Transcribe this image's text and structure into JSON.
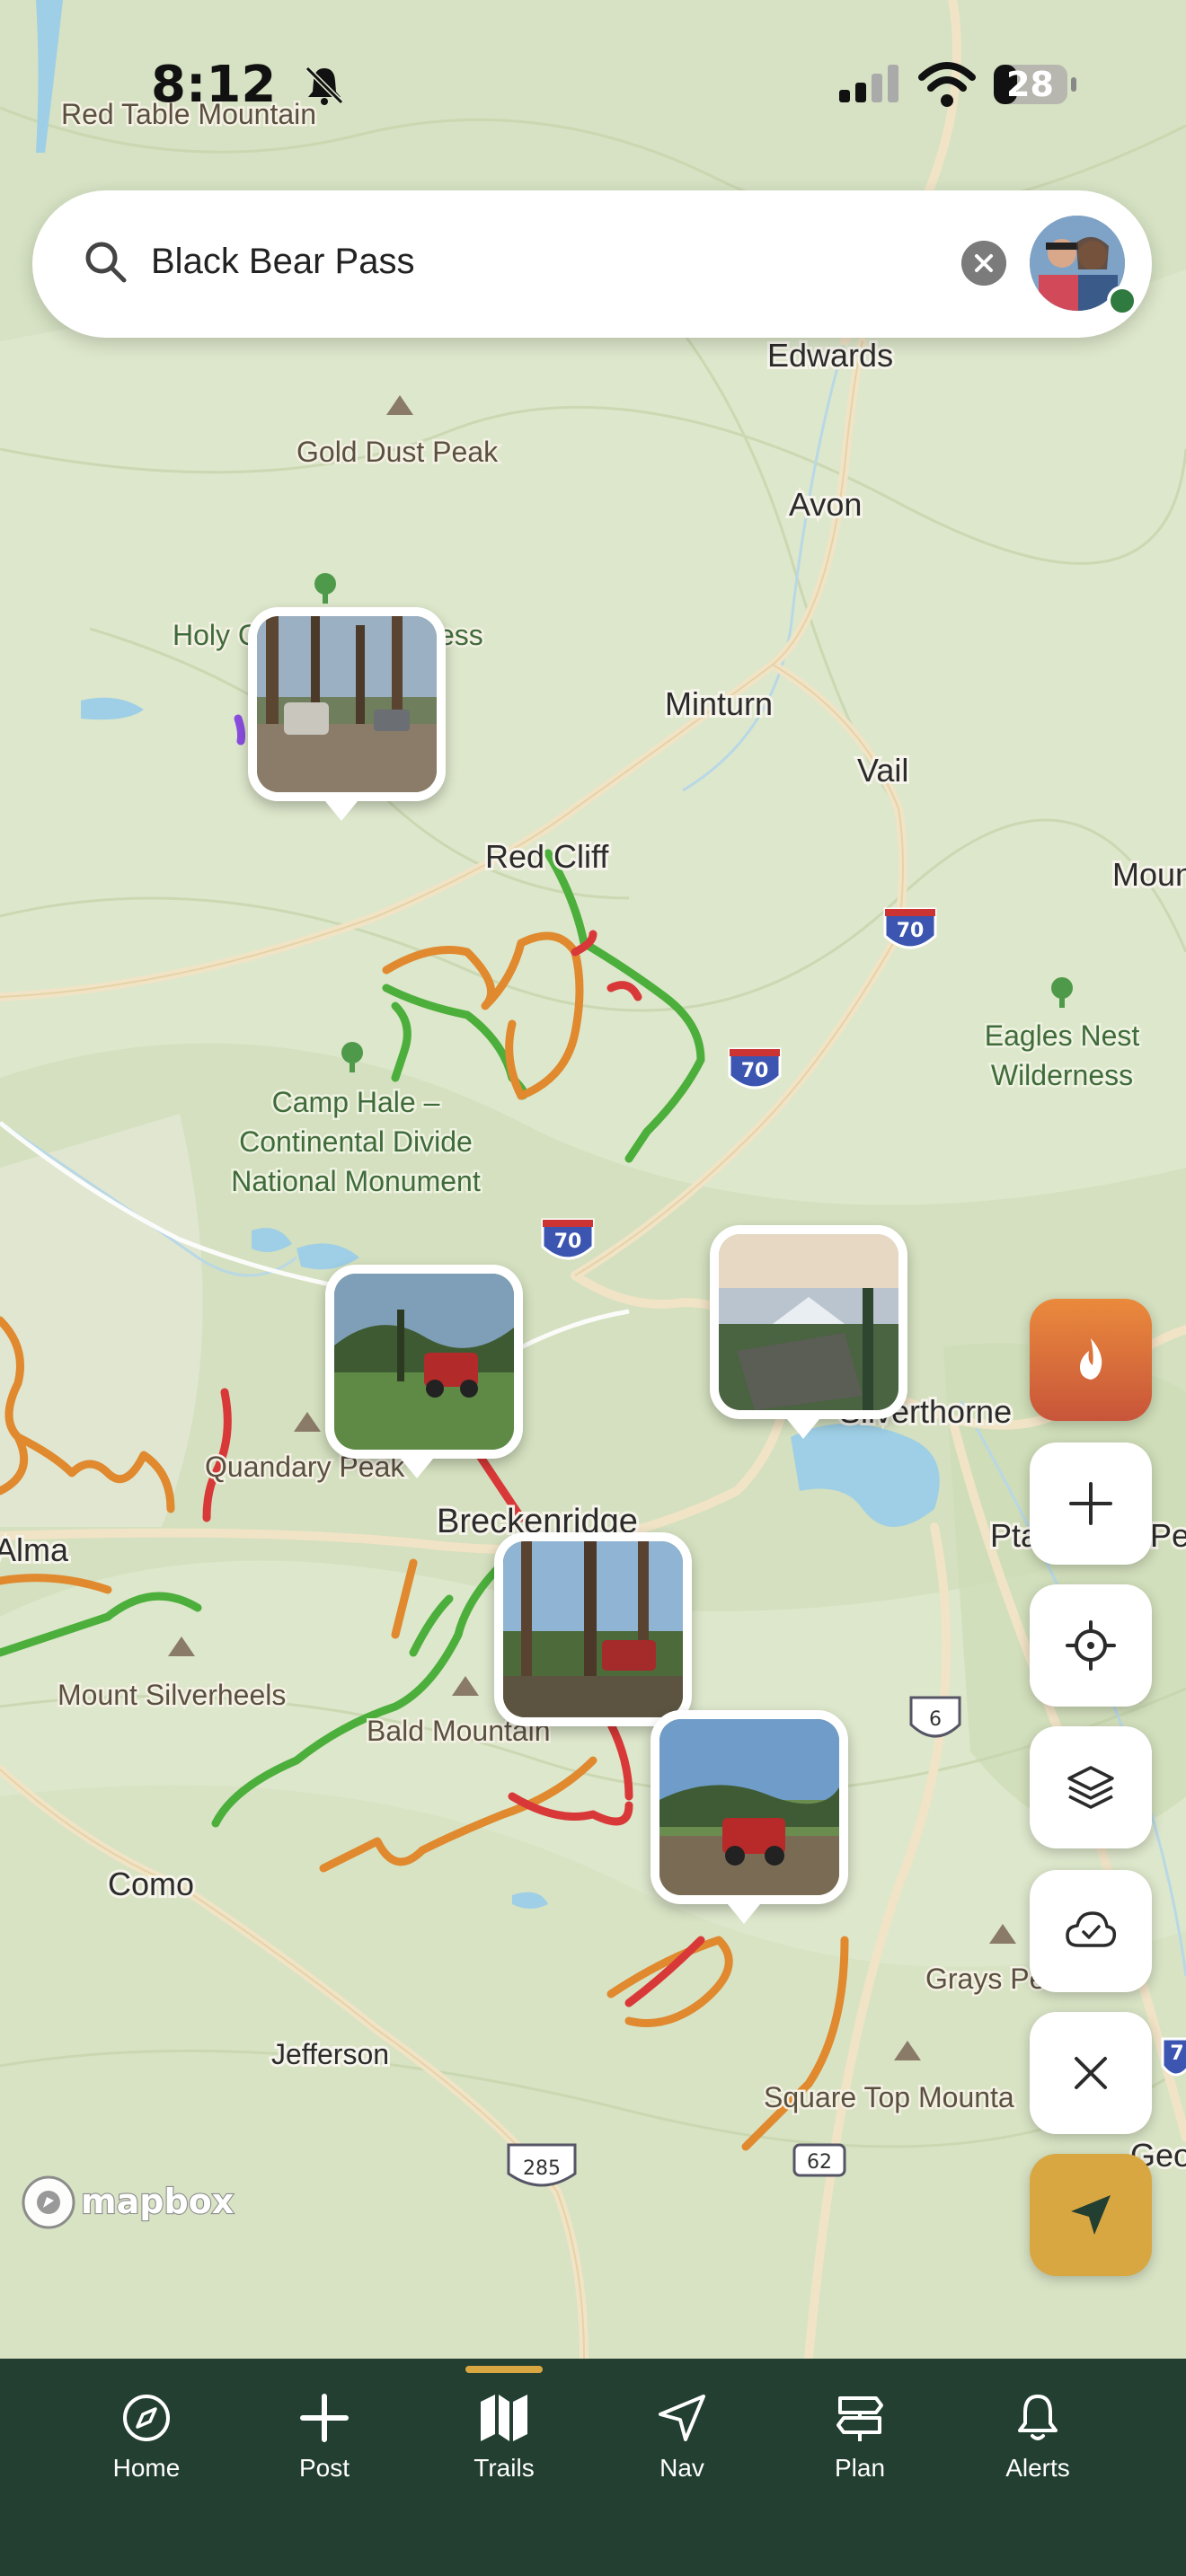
{
  "status_bar": {
    "time": "8:12",
    "battery": "28"
  },
  "search": {
    "query": "Black Bear Pass"
  },
  "map_labels": {
    "red_table_mountain": "Red Table Mountain",
    "edwards": "Edwards",
    "gold_dust_peak": "Gold Dust Peak",
    "avon": "Avon",
    "holy_cross": "Holy C",
    "holy_cross_tail": "ess",
    "minturn": "Minturn",
    "vail": "Vail",
    "red_cliff": "Red Cliff",
    "mount_right": "Moun",
    "eagles_nest_1": "Eagles Nest",
    "eagles_nest_2": "Wilderness",
    "camp_hale_1": "Camp Hale –",
    "camp_hale_2": "Continental Divide",
    "camp_hale_3": "National Monument",
    "quandary_peak": "Quandary Peak",
    "silverthorne": "Silverthorne",
    "breckenridge": "Breckenridge",
    "alma": "Alma",
    "pta": "Pta",
    "pea": "Pea",
    "mount_silverheels": "Mount Silverheels",
    "bald_mountain": "Bald Mountain",
    "como": "Como",
    "grays_peak": "Grays Pe",
    "jefferson": "Jefferson",
    "square_top": "Square Top Mounta",
    "geo": "Geo",
    "i70_a": "70",
    "i70_b": "70",
    "i70_c": "70",
    "us6": "6",
    "us285": "285",
    "r62": "62",
    "r7": "7"
  },
  "attribution": "mapbox",
  "icons": {
    "search": "search-icon",
    "clear": "close-icon",
    "fire": "fire-icon",
    "add": "plus-icon",
    "locate": "crosshair-icon",
    "layers": "layers-icon",
    "offline": "cloud-check-icon",
    "close": "close-icon",
    "navigate": "navigation-arrow-icon"
  },
  "nav": {
    "items": [
      {
        "label": "Home",
        "icon": "compass-icon"
      },
      {
        "label": "Post",
        "icon": "plus-icon"
      },
      {
        "label": "Trails",
        "icon": "map-icon"
      },
      {
        "label": "Nav",
        "icon": "navigation-arrow-icon"
      },
      {
        "label": "Plan",
        "icon": "signpost-icon"
      },
      {
        "label": "Alerts",
        "icon": "bell-icon"
      }
    ],
    "active": "Trails"
  },
  "colors": {
    "trail_easy": "#4caf3c",
    "trail_moderate": "#e0892e",
    "trail_hard": "#d93838",
    "accent": "#d9a742",
    "nav_bg": "#223f31"
  }
}
